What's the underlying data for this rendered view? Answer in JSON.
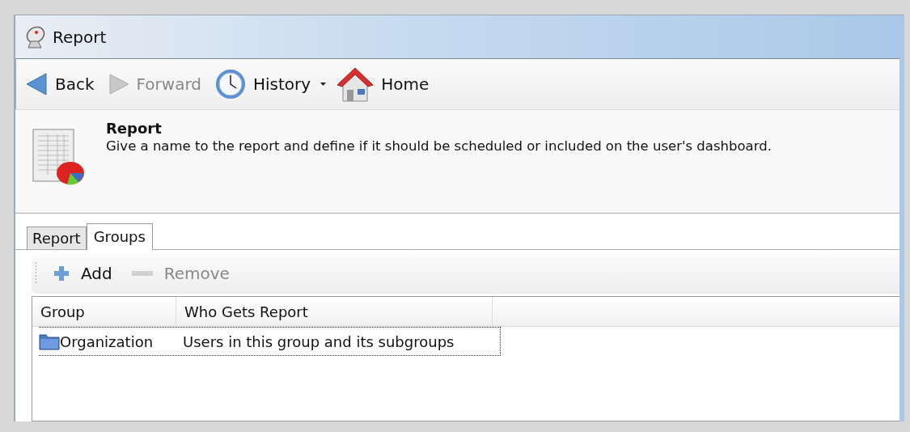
{
  "window": {
    "title": "Report"
  },
  "nav": [
    {
      "kind": "back",
      "label": "Back",
      "disabled": false,
      "dropdown": false
    },
    {
      "kind": "forward",
      "label": "Forward",
      "disabled": true,
      "dropdown": false
    },
    {
      "kind": "history",
      "label": "History",
      "disabled": false,
      "dropdown": true
    },
    {
      "kind": "home",
      "label": "Home",
      "disabled": false,
      "dropdown": false
    }
  ],
  "header": {
    "title": "Report",
    "description": "Give a name to the report and define if it should be scheduled or included on the user's dashboard."
  },
  "tabs": [
    {
      "label": "Report",
      "selected": false
    },
    {
      "label": "Groups",
      "selected": true
    }
  ],
  "actions": [
    {
      "kind": "add",
      "label": "Add",
      "disabled": false
    },
    {
      "kind": "remove",
      "label": "Remove",
      "disabled": true
    }
  ],
  "table": {
    "columns": [
      "Group",
      "Who Gets Report"
    ],
    "rows": [
      {
        "cells": [
          "Organization",
          "Users in this group and its subgroups"
        ],
        "focused": true
      }
    ]
  }
}
